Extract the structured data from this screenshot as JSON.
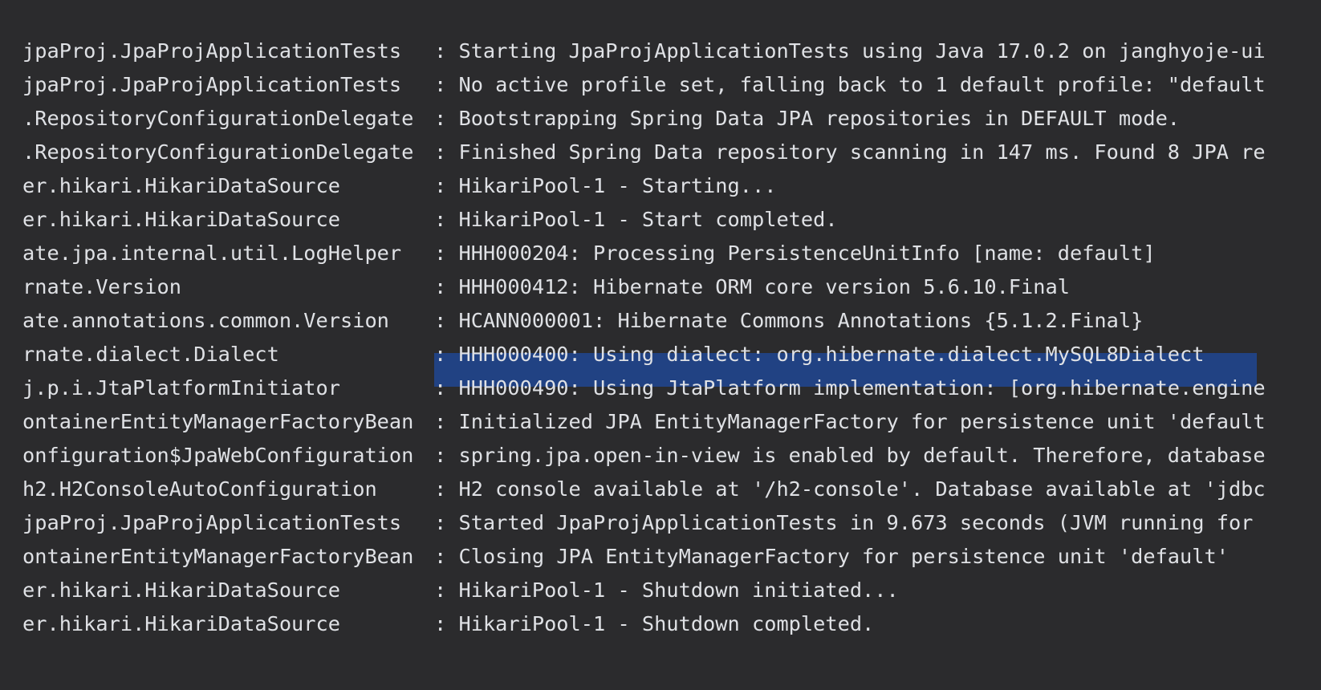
{
  "console": {
    "selected_line_index": 9,
    "colors": {
      "background": "#2b2b2d",
      "text": "#dfe1e5",
      "selection": "#214283"
    },
    "lines": [
      {
        "logger": "jpaProj.JpaProjApplicationTests",
        "message": ": Starting JpaProjApplicationTests using Java 17.0.2 on janghyoje-ui"
      },
      {
        "logger": "jpaProj.JpaProjApplicationTests",
        "message": ": No active profile set, falling back to 1 default profile: \"default"
      },
      {
        "logger": ".RepositoryConfigurationDelegate",
        "message": ": Bootstrapping Spring Data JPA repositories in DEFAULT mode."
      },
      {
        "logger": ".RepositoryConfigurationDelegate",
        "message": ": Finished Spring Data repository scanning in 147 ms. Found 8 JPA re"
      },
      {
        "logger": "er.hikari.HikariDataSource",
        "message": ": HikariPool-1 - Starting..."
      },
      {
        "logger": "er.hikari.HikariDataSource",
        "message": ": HikariPool-1 - Start completed."
      },
      {
        "logger": "ate.jpa.internal.util.LogHelper",
        "message": ": HHH000204: Processing PersistenceUnitInfo [name: default]"
      },
      {
        "logger": "rnate.Version",
        "message": ": HHH000412: Hibernate ORM core version 5.6.10.Final"
      },
      {
        "logger": "ate.annotations.common.Version",
        "message": ": HCANN000001: Hibernate Commons Annotations {5.1.2.Final}"
      },
      {
        "logger": "rnate.dialect.Dialect",
        "message": ": HHH000400: Using dialect: org.hibernate.dialect.MySQL8Dialect"
      },
      {
        "logger": "j.p.i.JtaPlatformInitiator",
        "message": ": HHH000490: Using JtaPlatform implementation: [org.hibernate.engine"
      },
      {
        "logger": "ontainerEntityManagerFactoryBean",
        "message": ": Initialized JPA EntityManagerFactory for persistence unit 'default"
      },
      {
        "logger": "onfiguration$JpaWebConfiguration",
        "message": ": spring.jpa.open-in-view is enabled by default. Therefore, database"
      },
      {
        "logger": "h2.H2ConsoleAutoConfiguration",
        "message": ": H2 console available at '/h2-console'. Database available at 'jdbc"
      },
      {
        "logger": "jpaProj.JpaProjApplicationTests",
        "message": ": Started JpaProjApplicationTests in 9.673 seconds (JVM running for"
      },
      {
        "logger": "ontainerEntityManagerFactoryBean",
        "message": ": Closing JPA EntityManagerFactory for persistence unit 'default'"
      },
      {
        "logger": "er.hikari.HikariDataSource",
        "message": ": HikariPool-1 - Shutdown initiated..."
      },
      {
        "logger": "er.hikari.HikariDataSource",
        "message": ": HikariPool-1 - Shutdown completed."
      }
    ]
  }
}
